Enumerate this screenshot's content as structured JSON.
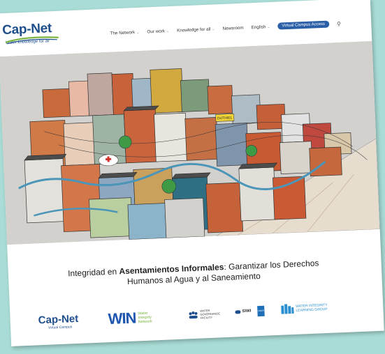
{
  "logo": {
    "title": "Cap-Net",
    "tagline": "Water knowledge for all"
  },
  "nav": {
    "items": [
      {
        "label": "The Network"
      },
      {
        "label": "Our work"
      },
      {
        "label": "Knowledge for all"
      },
      {
        "label": "Newsroom"
      },
      {
        "label": "English"
      }
    ],
    "cta": "Virtual Campus Access",
    "search_icon": "search-icon"
  },
  "hero": {
    "sign_text": "DUTHIEL"
  },
  "title": {
    "prefix": "Integridad en ",
    "bold": "Asentamientos Informales",
    "suffix": ": Garantizar los Derechos",
    "line2": "Humanos al Agua y al Saneamiento"
  },
  "partners": {
    "capnet": {
      "name": "Cap-Net",
      "sub": "Virtual Campus"
    },
    "win": {
      "name": "WIN",
      "sub1": "Water",
      "sub2": "Integrity",
      "sub3": "Network"
    },
    "wgf": {
      "line1": "WATER",
      "line2": "GOVERNANCE",
      "line3": "FACILITY"
    },
    "siwi": "SIWI",
    "undp": "UNDP",
    "wilg": {
      "line1": "WATER INTEGRITY",
      "line2": "LEARNING GROUP"
    }
  },
  "colors": {
    "background": "#a9dcd6",
    "brand_blue": "#1e4f8c",
    "cta_blue": "#2a5fa8",
    "win_blue": "#1f56b0",
    "win_green": "#7ab540"
  }
}
